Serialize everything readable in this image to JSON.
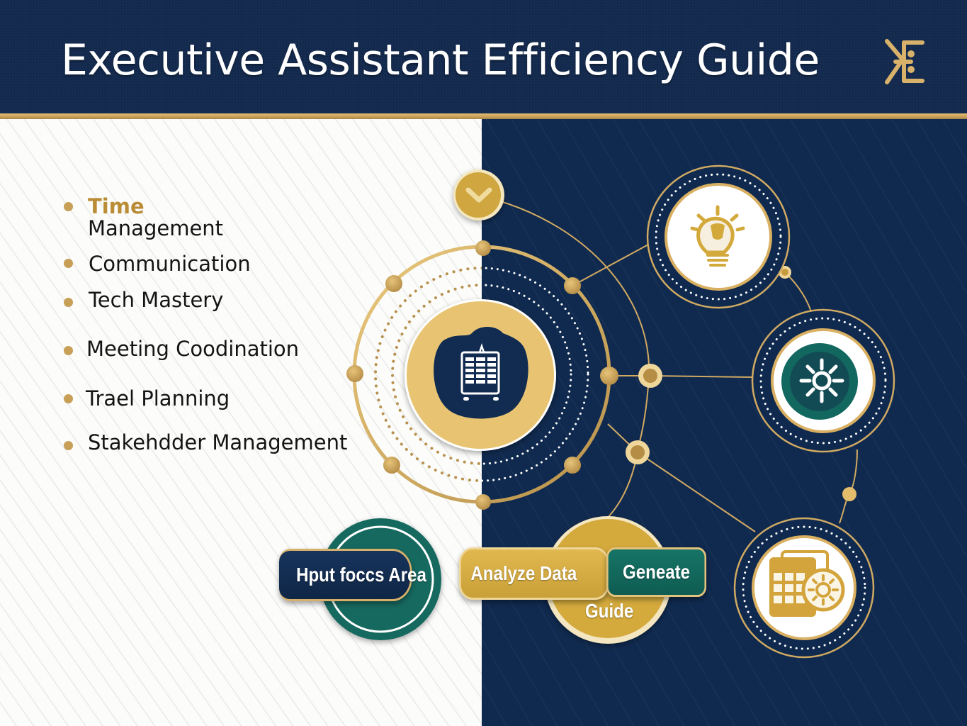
{
  "header": {
    "title": "Executive Assistant Efficiency Guide",
    "logo_icon": "ornate-e-monogram-icon"
  },
  "topics": {
    "items": [
      {
        "highlight": "Time",
        "label": "Management"
      },
      {
        "highlight": "",
        "label": "Communication"
      },
      {
        "highlight": "",
        "label": "Tech Mastery"
      },
      {
        "highlight": "",
        "label": "Meeting Coodination"
      },
      {
        "highlight": "",
        "label": "Trael Planning"
      },
      {
        "highlight": "",
        "label": "Stakehdder Management"
      }
    ]
  },
  "diagram": {
    "expand_icon": "chevron-down-icon",
    "hub_icon": "calendar-planner-icon",
    "nodes": [
      {
        "name": "idea-node",
        "icon": "lightbulb-icon"
      },
      {
        "name": "settings-node",
        "icon": "gear-icon"
      },
      {
        "name": "tools-node",
        "icon": "calculator-gear-icon"
      }
    ]
  },
  "workflow": {
    "input_label": "Hput foccs Area",
    "analyze_label": "Analyze  Data",
    "generate_label": "Geneate",
    "guide_label": "Guide"
  },
  "colors": {
    "navy": "#13294d",
    "gold": "#c79f57",
    "gold_light": "#e6c46e",
    "teal": "#116a5e",
    "white": "#ffffff"
  }
}
